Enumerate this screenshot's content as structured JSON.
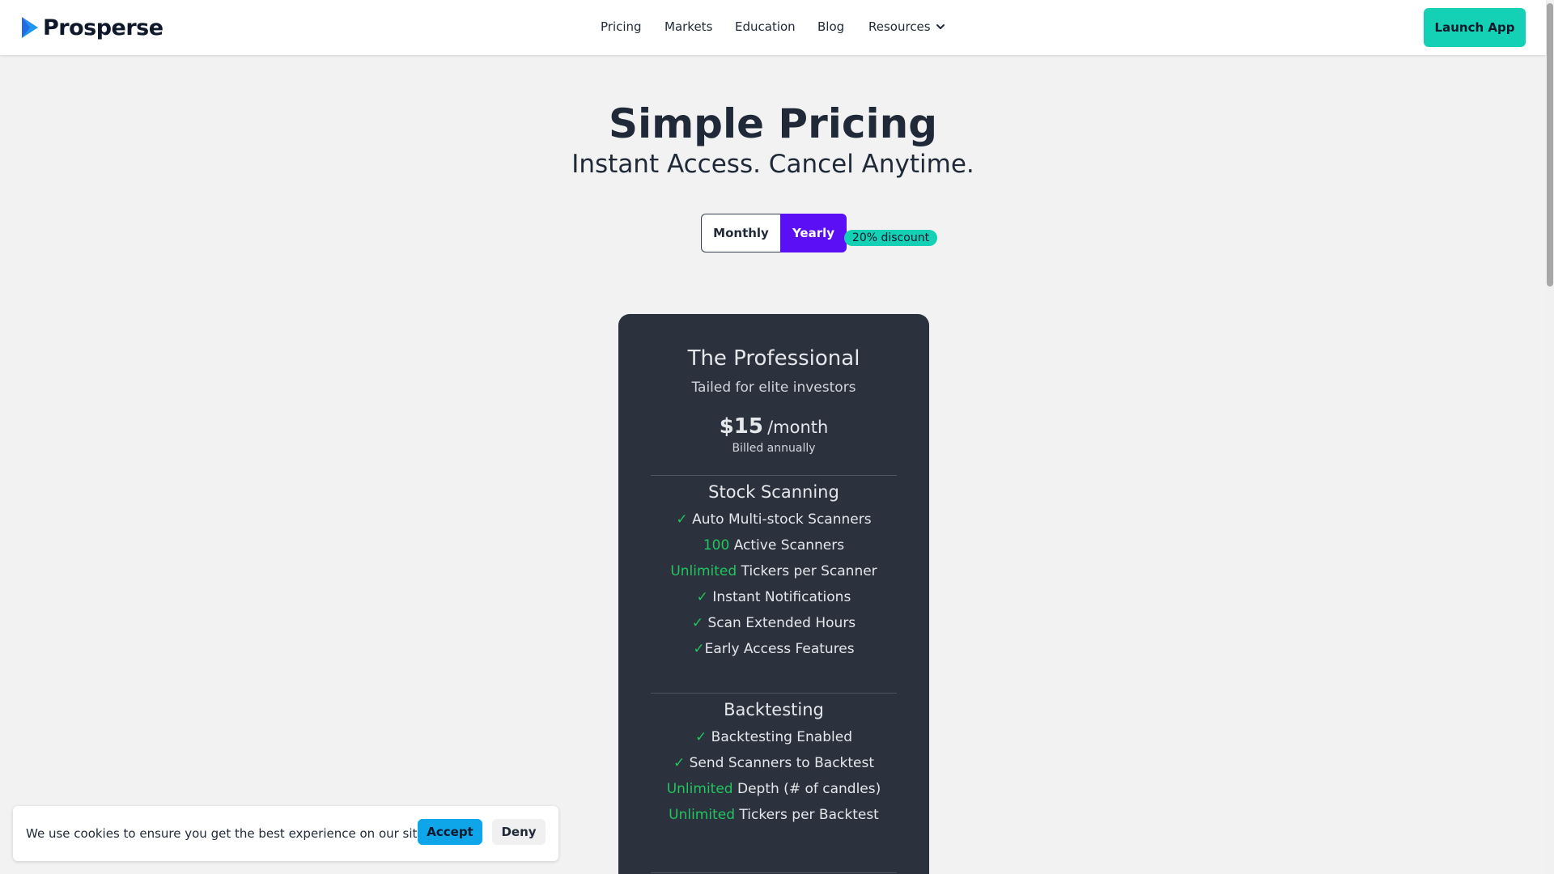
{
  "header": {
    "logo_text": "Prosperse",
    "nav": {
      "pricing": "Pricing",
      "markets": "Markets",
      "education": "Education",
      "blog": "Blog",
      "resources": "Resources"
    },
    "launch_label": "Launch App"
  },
  "hero": {
    "title": "Simple Pricing",
    "subtitle": "Instant Access. Cancel Anytime."
  },
  "billing_toggle": {
    "monthly": "Monthly",
    "yearly": "Yearly",
    "selected": "Yearly",
    "discount": "20% discount"
  },
  "plan": {
    "name": "The Professional",
    "tagline": "Tailed for elite investors",
    "price": "$15",
    "price_unit": "/month",
    "billing_note": "Billed annually",
    "sections": [
      {
        "title": "Stock Scanning",
        "features": [
          {
            "prefix": "✓",
            "text": "Auto Multi-stock Scanners"
          },
          {
            "prefix": "100",
            "text": "Active Scanners"
          },
          {
            "prefix": "Unlimited",
            "text": "Tickers per Scanner"
          },
          {
            "prefix": "✓",
            "text": "Instant Notifications"
          },
          {
            "prefix": "✓",
            "text": "Scan Extended Hours"
          },
          {
            "prefix": "✓",
            "text": "Early Access Features"
          }
        ]
      },
      {
        "title": "Backtesting",
        "features": [
          {
            "prefix": "✓",
            "text": "Backtesting Enabled"
          },
          {
            "prefix": "✓",
            "text": "Send Scanners to Backtest"
          },
          {
            "prefix": "Unlimited",
            "text": "Depth (# of candles)"
          },
          {
            "prefix": "Unlimited",
            "text": "Tickers per Backtest"
          }
        ]
      }
    ]
  },
  "cookie_banner": {
    "message": "We use cookies to ensure you get the best experience on our site.",
    "accept": "Accept",
    "deny": "Deny"
  },
  "colors": {
    "accent_teal": "#14d0b4",
    "accent_purple": "#5b0ff5",
    "card_bg": "#2b313d",
    "feature_green": "#22c55e",
    "accept_blue": "#0ea5e9"
  }
}
